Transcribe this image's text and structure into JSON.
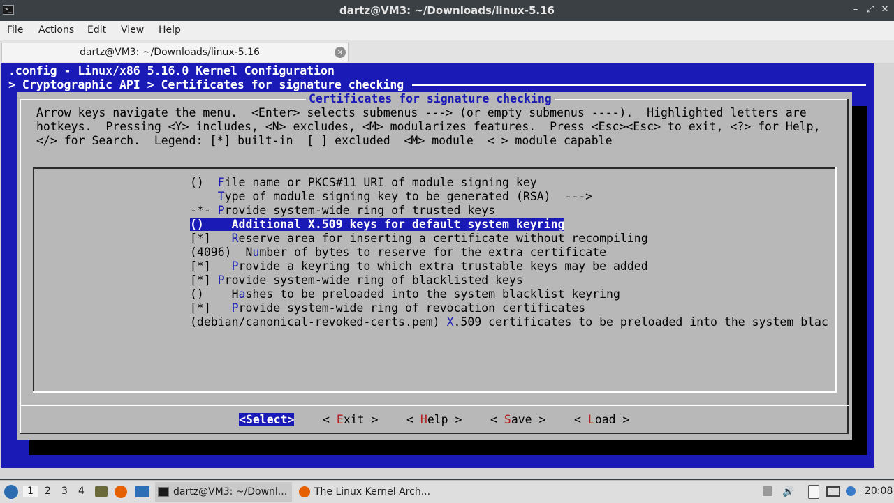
{
  "window": {
    "title": "dartz@VM3: ~/Downloads/linux-5.16",
    "app_icon": ">_",
    "controls": [
      "–",
      "⤢",
      "✕"
    ]
  },
  "menubar": {
    "items": [
      "File",
      "Actions",
      "Edit",
      "View",
      "Help"
    ]
  },
  "tab": {
    "label": "dartz@VM3: ~/Downloads/linux-5.16",
    "close_icon": "×"
  },
  "terminal": {
    "config_line": ".config - Linux/x86 5.16.0 Kernel Configuration",
    "breadcrumb": "> Cryptographic API > Certificates for signature checking",
    "dialog_title": "Certificates for signature checking",
    "help_lines": [
      "Arrow keys navigate the menu.  <Enter> selects submenus ---> (or empty submenus ----).  Highlighted letters are",
      "hotkeys.  Pressing <Y> includes, <N> excludes, <M> modularizes features.  Press <Esc><Esc> to exit, <?> for Help,",
      "</> for Search.  Legend: [*] built-in  [ ] excluded  <M> module  < > module capable"
    ],
    "menu_items": [
      {
        "pre": "()  ",
        "hk": "F",
        "post": "ile name or PKCS#11 URI of module signing key"
      },
      {
        "pre": "    ",
        "hk": "T",
        "post": "ype of module signing key to be generated (RSA)  --->"
      },
      {
        "pre": "-*- ",
        "hk": "P",
        "post": "rovide system-wide ring of trusted keys"
      },
      {
        "pre": "()    ",
        "hk": "A",
        "post": "dditional X.509 keys for default system keyring"
      },
      {
        "pre": "[*]   ",
        "hk": "R",
        "post": "eserve area for inserting a certificate without recompiling"
      },
      {
        "pre": "(4096)  N",
        "hk": "u",
        "post": "mber of bytes to reserve for the extra certificate"
      },
      {
        "pre": "[*]   ",
        "hk": "P",
        "post": "rovide a keyring to which extra trustable keys may be added"
      },
      {
        "pre": "[*] ",
        "hk": "P",
        "post": "rovide system-wide ring of blacklisted keys"
      },
      {
        "pre": "()    H",
        "hk": "a",
        "post": "shes to be preloaded into the system blacklist keyring"
      },
      {
        "pre": "[*]   ",
        "hk": "P",
        "post": "rovide system-wide ring of revocation certificates"
      },
      {
        "pre": "(debian/canonical-revoked-certs.pem) ",
        "hk": "X",
        "post": ".509 certificates to be preloaded into the system blac"
      }
    ],
    "selected_index": 3,
    "buttons": [
      {
        "pre": "<",
        "hk": "S",
        "post": "elect>"
      },
      {
        "pre": "< ",
        "hk": "E",
        "post": "xit >"
      },
      {
        "pre": "< ",
        "hk": "H",
        "post": "elp >"
      },
      {
        "pre": "< ",
        "hk": "S",
        "post": "ave >"
      },
      {
        "pre": "< ",
        "hk": "L",
        "post": "oad >"
      }
    ]
  },
  "taskbar": {
    "workspaces": [
      "1",
      "2",
      "3",
      "4"
    ],
    "tasks": [
      {
        "label": "dartz@VM3: ~/Downl...",
        "icon": "terminal-icon"
      },
      {
        "label": "The Linux Kernel Arch...",
        "icon": "firefox-icon"
      }
    ],
    "clock": "20:08"
  },
  "colors": {
    "kconfig_blue": "#1a1ab6",
    "dialog_grey": "#b8b8b8",
    "hotkey_red": "#b22222"
  }
}
